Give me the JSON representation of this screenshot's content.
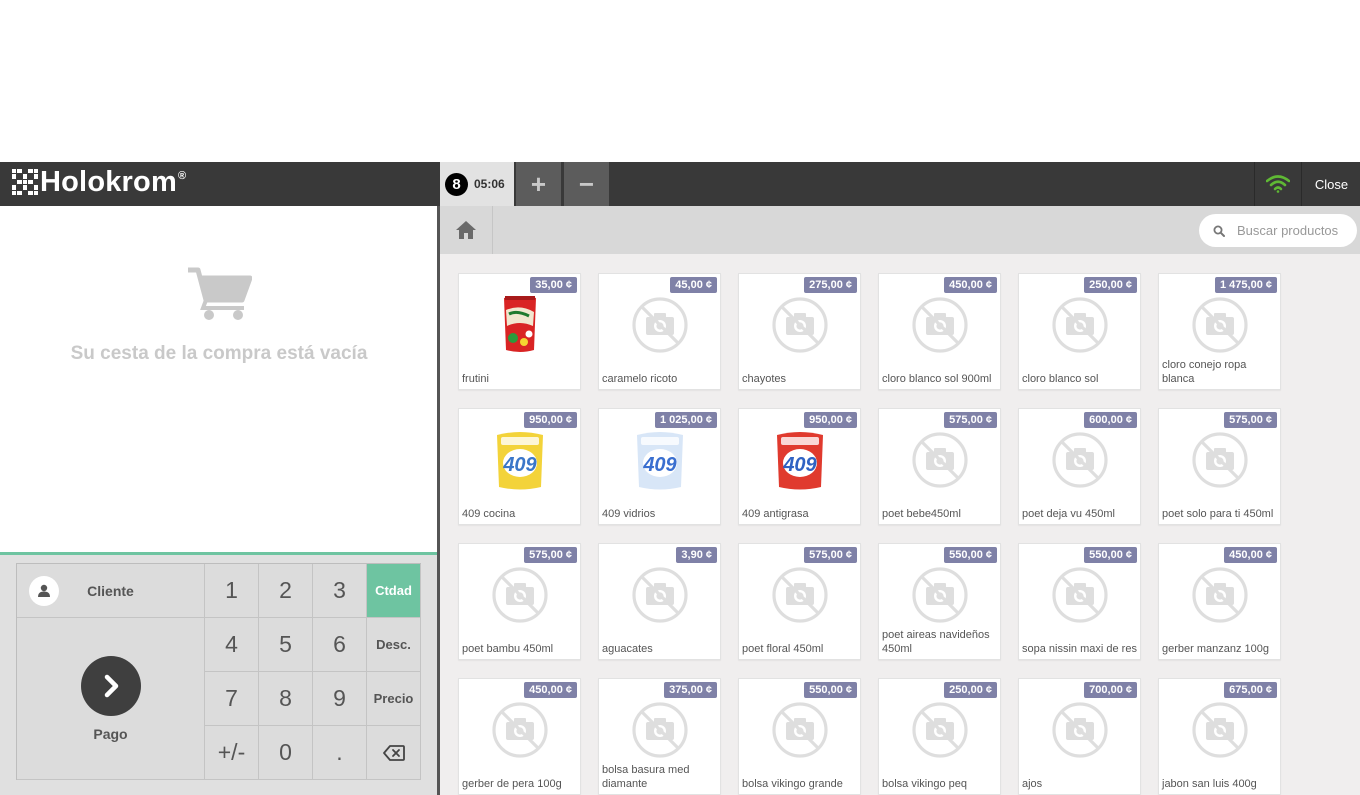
{
  "header": {
    "brand": "Holokrom",
    "brand_mark": "®",
    "order_number": "8",
    "order_time": "05:06",
    "add_order_label": "+",
    "remove_order_label": "−",
    "close_label": "Close",
    "wifi_color": "#5fb934"
  },
  "cart": {
    "empty_message": "Su cesta de la compra está vacía"
  },
  "numpad": {
    "customer_label": "Cliente",
    "pay_label": "Pago",
    "keys": [
      "1",
      "2",
      "3",
      "4",
      "5",
      "6",
      "7",
      "8",
      "9",
      "+/-",
      "0",
      "."
    ],
    "modes": [
      "Ctdad",
      "Desc.",
      "Precio"
    ],
    "active_mode_color": "#6ec4a1"
  },
  "search": {
    "placeholder": "Buscar productos"
  },
  "products": [
    {
      "name": "frutini",
      "price": "35,00 ¢",
      "image": "candy-bag"
    },
    {
      "name": "caramelo ricoto",
      "price": "45,00 ¢",
      "image": "none"
    },
    {
      "name": "chayotes",
      "price": "275,00 ¢",
      "image": "none"
    },
    {
      "name": "cloro blanco sol 900ml",
      "price": "450,00 ¢",
      "image": "none"
    },
    {
      "name": "cloro blanco sol",
      "price": "250,00 ¢",
      "image": "none"
    },
    {
      "name": "cloro conejo ropa blanca",
      "price": "1 475,00 ¢",
      "image": "none"
    },
    {
      "name": "409 cocina",
      "price": "950,00 ¢",
      "image": "detergent-yellow"
    },
    {
      "name": "409 vidrios",
      "price": "1 025,00 ¢",
      "image": "detergent-blue"
    },
    {
      "name": "409 antigrasa",
      "price": "950,00 ¢",
      "image": "detergent-red"
    },
    {
      "name": "poet bebe450ml",
      "price": "575,00 ¢",
      "image": "none"
    },
    {
      "name": "poet deja vu 450ml",
      "price": "600,00 ¢",
      "image": "none"
    },
    {
      "name": "poet solo para ti 450ml",
      "price": "575,00 ¢",
      "image": "none"
    },
    {
      "name": "poet bambu 450ml",
      "price": "575,00 ¢",
      "image": "none"
    },
    {
      "name": "aguacates",
      "price": "3,90 ¢",
      "image": "none"
    },
    {
      "name": "poet floral 450ml",
      "price": "575,00 ¢",
      "image": "none"
    },
    {
      "name": "poet aireas navideños 450ml",
      "price": "550,00 ¢",
      "image": "none"
    },
    {
      "name": "sopa nissin maxi de res",
      "price": "550,00 ¢",
      "image": "none"
    },
    {
      "name": "gerber manzanz 100g",
      "price": "450,00 ¢",
      "image": "none"
    },
    {
      "name": "gerber de pera 100g",
      "price": "450,00 ¢",
      "image": "none"
    },
    {
      "name": "bolsa basura med diamante",
      "price": "375,00 ¢",
      "image": "none"
    },
    {
      "name": "bolsa vikingo grande",
      "price": "550,00 ¢",
      "image": "none"
    },
    {
      "name": "bolsa vikingo peq",
      "price": "250,00 ¢",
      "image": "none"
    },
    {
      "name": "ajos",
      "price": "700,00 ¢",
      "image": "none"
    },
    {
      "name": "jabon san luis 400g",
      "price": "675,00 ¢",
      "image": "none"
    }
  ]
}
